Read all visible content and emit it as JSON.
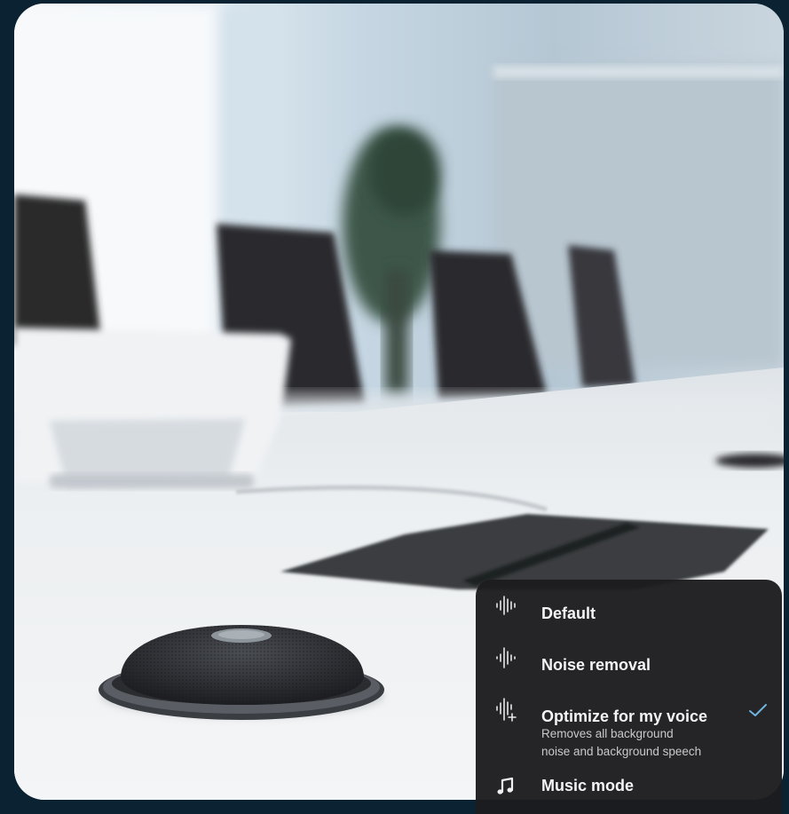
{
  "menu": {
    "items": [
      {
        "label": "Default",
        "icon": "waveform-icon",
        "selected": false
      },
      {
        "label": "Noise removal",
        "icon": "noise-removal-icon",
        "selected": false
      },
      {
        "label": "Optimize for my voice",
        "icon": "voice-optimize-icon",
        "selected": true,
        "description_line1": "Removes all background",
        "description_line2": "noise and background speech"
      },
      {
        "label": "Music mode",
        "icon": "music-note-icon",
        "selected": false
      }
    ]
  },
  "colors": {
    "accent_check": "#6fb3e0",
    "menu_bg": "#1c1c1e",
    "page_bg": "#0b2233"
  }
}
